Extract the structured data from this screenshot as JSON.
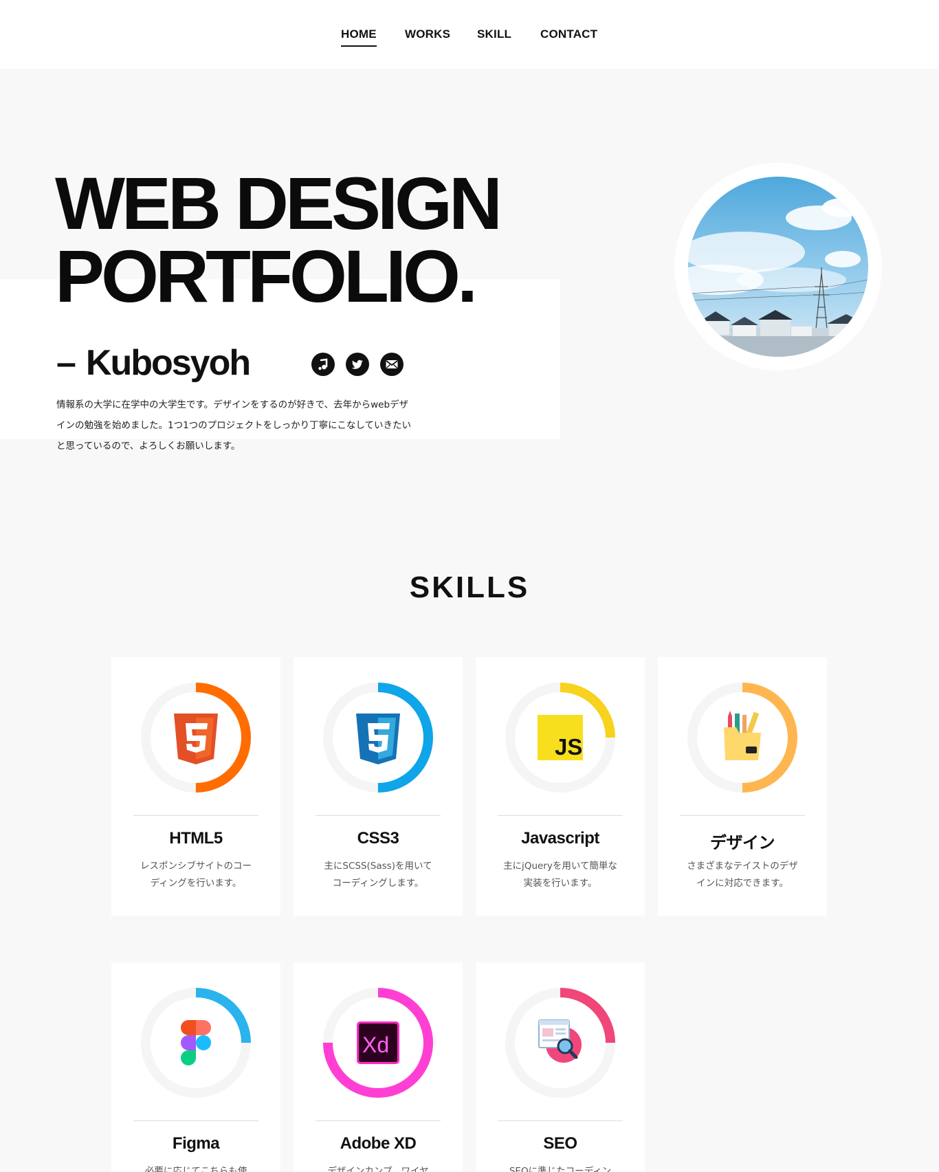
{
  "nav": {
    "items": [
      {
        "label": "HOME",
        "active": true
      },
      {
        "label": "WORKS",
        "active": false
      },
      {
        "label": "SKILL",
        "active": false
      },
      {
        "label": "CONTACT",
        "active": false
      }
    ]
  },
  "hero": {
    "title_line1": "WEB DESIGN",
    "title_line2": "PORTFOLIO.",
    "name_dash": "–",
    "name": "Kubosyoh",
    "description": "情報系の大学に在学中の大学生です。デザインをするのが好きで、去年からwebデザインの勉強を始めました。1つ1つのプロジェクトをしっかり丁寧にこなしていきたいと思っているので、よろしくお願いします。",
    "socials": [
      {
        "icon": "music-note-icon"
      },
      {
        "icon": "twitter-icon"
      },
      {
        "icon": "mail-icon"
      }
    ],
    "avatar": "sky-with-power-tower-photo"
  },
  "skills": {
    "title": "SKILLS",
    "cards": [
      {
        "name": "HTML5",
        "desc": "レスポンシブサイトのコーディングを行います。",
        "icon": "html5-icon",
        "color": "#ff6d00",
        "level": 0.5
      },
      {
        "name": "CSS3",
        "desc": "主にSCSS(Sass)を用いてコーディングします。",
        "icon": "css3-icon",
        "color": "#0ea5e9",
        "level": 0.5
      },
      {
        "name": "Javascript",
        "desc": "主にjQueryを用いて簡単な実装を行います。",
        "icon": "javascript-icon",
        "color": "#f7d21e",
        "level": 0.25
      },
      {
        "name": "デザイン",
        "desc": "さまざまなテイストのデザインに対応できます。",
        "icon": "design-tools-icon",
        "color": "#ffb650",
        "level": 0.5
      },
      {
        "name": "Figma",
        "desc": "必要に応じてこちらも使",
        "icon": "figma-icon",
        "color": "#2ab3ec",
        "level": 0.25
      },
      {
        "name": "Adobe XD",
        "desc": "デザインカンプ、ワイヤ",
        "icon": "adobe-xd-icon",
        "color": "#ff3fd4",
        "level": 0.75
      },
      {
        "name": "SEO",
        "desc": "SEOに準じたコーディン",
        "icon": "seo-icon",
        "color": "#f0467a",
        "level": 0.25
      }
    ]
  }
}
